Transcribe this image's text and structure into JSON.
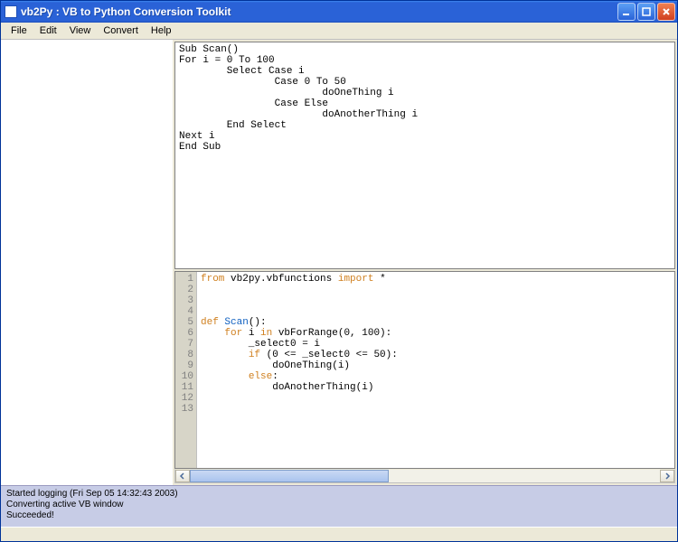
{
  "window": {
    "title": "vb2Py : VB to Python Conversion Toolkit"
  },
  "menu": {
    "file": "File",
    "edit": "Edit",
    "view": "View",
    "convert": "Convert",
    "help": "Help"
  },
  "vb_code": "Sub Scan()\nFor i = 0 To 100\n        Select Case i\n                Case 0 To 50\n                        doOneThing i\n                Case Else\n                        doAnotherThing i\n        End Select\nNext i\nEnd Sub",
  "py_lines": [
    {
      "n": "1",
      "tokens": [
        {
          "t": "from ",
          "c": "kw"
        },
        {
          "t": "vb2py.vbfunctions ",
          "c": "op"
        },
        {
          "t": "import ",
          "c": "kw"
        },
        {
          "t": "*",
          "c": "op"
        }
      ]
    },
    {
      "n": "2",
      "tokens": []
    },
    {
      "n": "3",
      "tokens": []
    },
    {
      "n": "4",
      "tokens": []
    },
    {
      "n": "5",
      "tokens": [
        {
          "t": "def ",
          "c": "kw"
        },
        {
          "t": "Scan",
          "c": "fn"
        },
        {
          "t": "():",
          "c": "op"
        }
      ]
    },
    {
      "n": "6",
      "tokens": [
        {
          "t": "    ",
          "c": "op"
        },
        {
          "t": "for ",
          "c": "kw"
        },
        {
          "t": "i ",
          "c": "op"
        },
        {
          "t": "in ",
          "c": "kw"
        },
        {
          "t": "vbForRange(0, 100):",
          "c": "op"
        }
      ]
    },
    {
      "n": "7",
      "tokens": [
        {
          "t": "        _select0 = i",
          "c": "op"
        }
      ]
    },
    {
      "n": "8",
      "tokens": [
        {
          "t": "        ",
          "c": "op"
        },
        {
          "t": "if ",
          "c": "kw"
        },
        {
          "t": "(0 <= _select0 <= 50):",
          "c": "op"
        }
      ]
    },
    {
      "n": "9",
      "tokens": [
        {
          "t": "            doOneThing(i)",
          "c": "op"
        }
      ]
    },
    {
      "n": "10",
      "tokens": [
        {
          "t": "        ",
          "c": "op"
        },
        {
          "t": "else",
          "c": "kw"
        },
        {
          "t": ":",
          "c": "op"
        }
      ]
    },
    {
      "n": "11",
      "tokens": [
        {
          "t": "            doAnotherThing(i)",
          "c": "op"
        }
      ]
    },
    {
      "n": "12",
      "tokens": []
    },
    {
      "n": "13",
      "tokens": []
    }
  ],
  "log": {
    "l1": "Started logging (Fri Sep 05 14:32:43 2003)",
    "l2": "Converting active VB window",
    "l3": "Succeeded!"
  }
}
